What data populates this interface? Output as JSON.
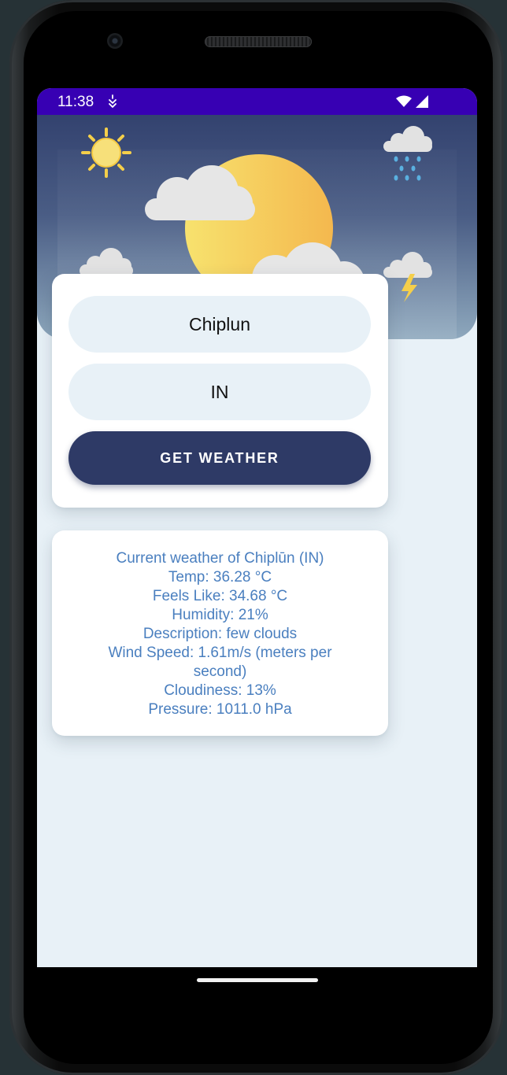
{
  "status_bar": {
    "time": "11:38"
  },
  "form": {
    "city_value": "Chiplun",
    "country_value": "IN",
    "submit_label": "GET WEATHER"
  },
  "result": {
    "lines": [
      "Current weather of Chiplūn (IN)",
      "Temp: 36.28 °C",
      "Feels Like: 34.68 °C",
      "Humidity: 21%",
      "Description: few clouds",
      "Wind Speed: 1.61m/s (meters per second)",
      "Cloudiness: 13%",
      "Pressure: 1011.0 hPa"
    ]
  },
  "icons": {
    "header": [
      "sun-icon",
      "rain-cloud-icon",
      "snow-cloud-icon",
      "thunder-cloud-icon",
      "sun-behind-clouds-illustration"
    ],
    "status": [
      "app-notification-icon",
      "wifi-icon",
      "cellular-signal-icon"
    ]
  },
  "colors": {
    "status_bar": "#3700b3",
    "header_top": "#33426f",
    "header_bottom": "#8ea8bd",
    "button": "#2e3a66",
    "result_text": "#4a7fbf",
    "screen_bg": "#e8f1f7"
  }
}
